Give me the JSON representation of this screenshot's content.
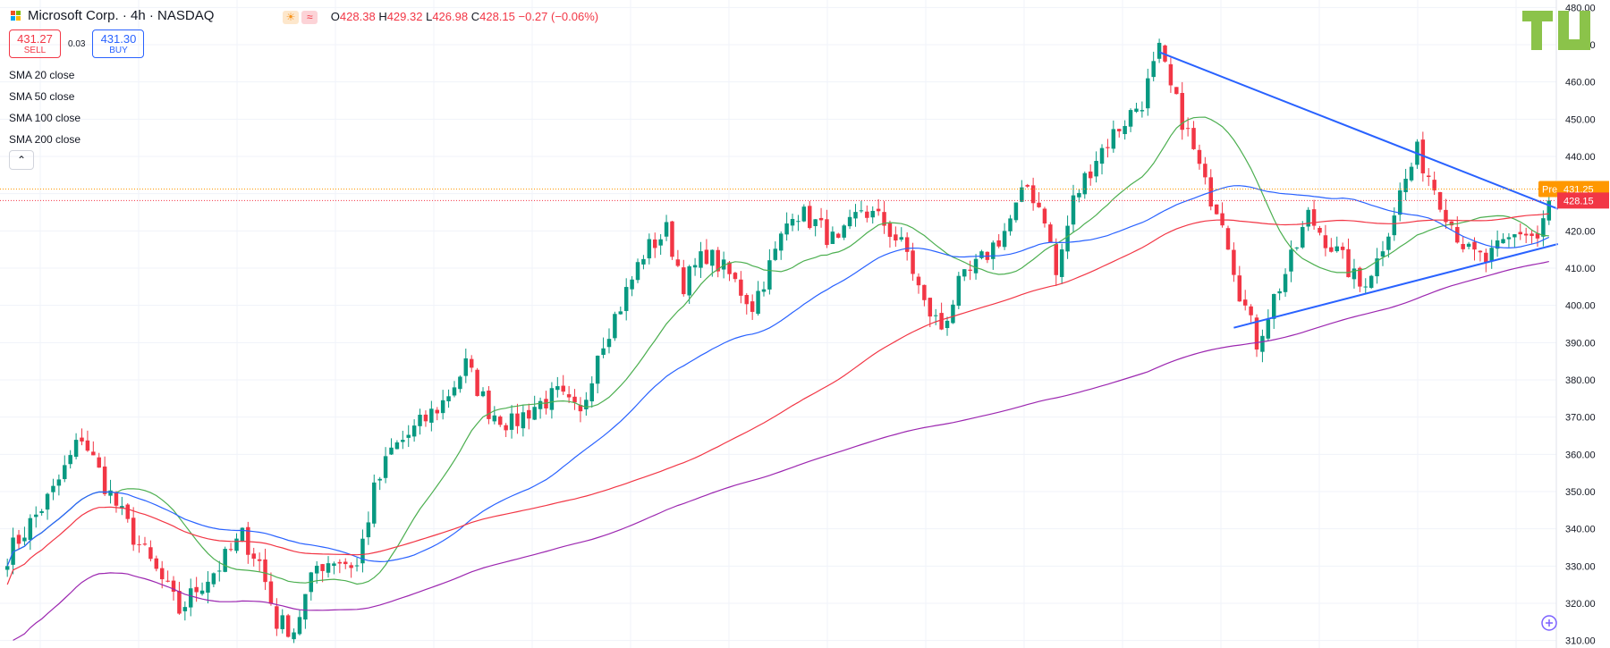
{
  "header": {
    "title": "Microsoft Corp. · 4h · NASDAQ",
    "open_label": "O",
    "open": "428.38",
    "high_label": "H",
    "high": "429.32",
    "low_label": "L",
    "low": "426.98",
    "close_label": "C",
    "close": "428.15",
    "change": "−0.27 (−0.06%)"
  },
  "trade": {
    "sell_price": "431.27",
    "sell_label": "SELL",
    "spread": "0.03",
    "buy_price": "431.30",
    "buy_label": "BUY"
  },
  "indicators": [
    "SMA 20 close",
    "SMA 50 close",
    "SMA 100 close",
    "SMA 200 close"
  ],
  "collapse_icon": "chevron-up-icon",
  "logo_text": "TV",
  "price_tags": {
    "premarket_label": "Pre",
    "premarket_price": "431.25",
    "last_price": "428.15"
  },
  "colors": {
    "up": "#089981",
    "down": "#f23645",
    "sma20": "#4caf50",
    "sma50": "#2962ff",
    "sma100": "#f23645",
    "sma200": "#9c27b0",
    "trendline": "#2962ff",
    "premarket": "#ff9800"
  },
  "chart_data": {
    "type": "candlestick",
    "symbol": "Microsoft Corp.",
    "interval": "4h",
    "exchange": "NASDAQ",
    "y_ticks": [
      310,
      320,
      330,
      340,
      350,
      360,
      370,
      380,
      390,
      400,
      410,
      420,
      430,
      440,
      450,
      460,
      470,
      480
    ],
    "ylim": [
      308,
      482
    ],
    "price_path": [
      [
        0,
        333
      ],
      [
        8,
        350
      ],
      [
        13,
        365
      ],
      [
        17,
        352
      ],
      [
        22,
        338
      ],
      [
        27,
        326
      ],
      [
        30,
        318
      ],
      [
        33,
        324
      ],
      [
        37,
        330
      ],
      [
        41,
        338
      ],
      [
        44,
        331
      ],
      [
        47,
        315
      ],
      [
        50,
        313
      ],
      [
        54,
        330
      ],
      [
        57,
        332
      ],
      [
        61,
        330
      ],
      [
        64,
        350
      ],
      [
        67,
        361
      ],
      [
        72,
        368
      ],
      [
        76,
        374
      ],
      [
        80,
        384
      ],
      [
        84,
        372
      ],
      [
        88,
        368
      ],
      [
        92,
        373
      ],
      [
        96,
        376
      ],
      [
        100,
        370
      ],
      [
        103,
        388
      ],
      [
        107,
        400
      ],
      [
        111,
        414
      ],
      [
        115,
        420
      ],
      [
        118,
        406
      ],
      [
        122,
        414
      ],
      [
        126,
        408
      ],
      [
        130,
        400
      ],
      [
        134,
        414
      ],
      [
        137,
        426
      ],
      [
        141,
        422
      ],
      [
        145,
        416
      ],
      [
        149,
        426
      ],
      [
        153,
        422
      ],
      [
        157,
        414
      ],
      [
        160,
        400
      ],
      [
        163,
        394
      ],
      [
        166,
        405
      ],
      [
        170,
        412
      ],
      [
        174,
        420
      ],
      [
        178,
        432
      ],
      [
        181,
        424
      ],
      [
        183,
        408
      ],
      [
        186,
        428
      ],
      [
        190,
        440
      ],
      [
        194,
        448
      ],
      [
        198,
        455
      ],
      [
        201,
        468
      ],
      [
        203,
        458
      ],
      [
        206,
        446
      ],
      [
        209,
        432
      ],
      [
        212,
        424
      ],
      [
        215,
        404
      ],
      [
        218,
        390
      ],
      [
        221,
        402
      ],
      [
        224,
        412
      ],
      [
        227,
        424
      ],
      [
        230,
        418
      ],
      [
        233,
        412
      ],
      [
        236,
        405
      ],
      [
        239,
        412
      ],
      [
        243,
        430
      ],
      [
        246,
        441
      ],
      [
        249,
        432
      ],
      [
        252,
        422
      ],
      [
        255,
        414
      ],
      [
        258,
        412
      ],
      [
        261,
        416
      ],
      [
        264,
        420
      ],
      [
        267,
        418
      ],
      [
        269,
        428
      ]
    ],
    "bars": 270,
    "sma_periods": [
      20,
      50,
      100,
      200
    ],
    "trendlines": [
      {
        "name": "upper",
        "from": {
          "bar": 201,
          "price": 468
        },
        "to": {
          "bar": 269,
          "price": 424
        }
      },
      {
        "name": "lower",
        "from": {
          "bar": 214,
          "price": 394
        },
        "to": {
          "bar": 269,
          "price": 416
        }
      }
    ],
    "premarket_price": 431.25,
    "last_price": 428.15
  }
}
